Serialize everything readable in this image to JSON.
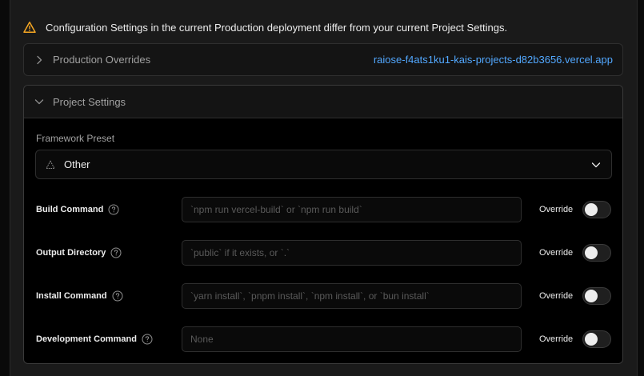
{
  "banner": {
    "text": "Configuration Settings in the current Production deployment differ from your current Project Settings.",
    "icon": "warning-icon",
    "icon_color": "#f5a623"
  },
  "production_overrides": {
    "title": "Production Overrides",
    "link": "raiose-f4ats1ku1-kais-projects-d82b3656.vercel.app",
    "link_color": "#52a8ff",
    "expanded": false
  },
  "project_settings": {
    "title": "Project Settings",
    "expanded": true,
    "framework_preset": {
      "label": "Framework Preset",
      "value": "Other",
      "icon": "triangle-icon"
    },
    "settings": [
      {
        "label": "Build Command",
        "placeholder": "`npm run vercel-build` or `npm run build`",
        "value": "",
        "override_label": "Override",
        "override_on": false
      },
      {
        "label": "Output Directory",
        "placeholder": "`public` if it exists, or `.`",
        "value": "",
        "override_label": "Override",
        "override_on": false
      },
      {
        "label": "Install Command",
        "placeholder": "`yarn install`, `pnpm install`, `npm install`, or `bun install`",
        "value": "",
        "override_label": "Override",
        "override_on": false
      },
      {
        "label": "Development Command",
        "placeholder": "None",
        "value": "",
        "override_label": "Override",
        "override_on": false
      }
    ]
  }
}
